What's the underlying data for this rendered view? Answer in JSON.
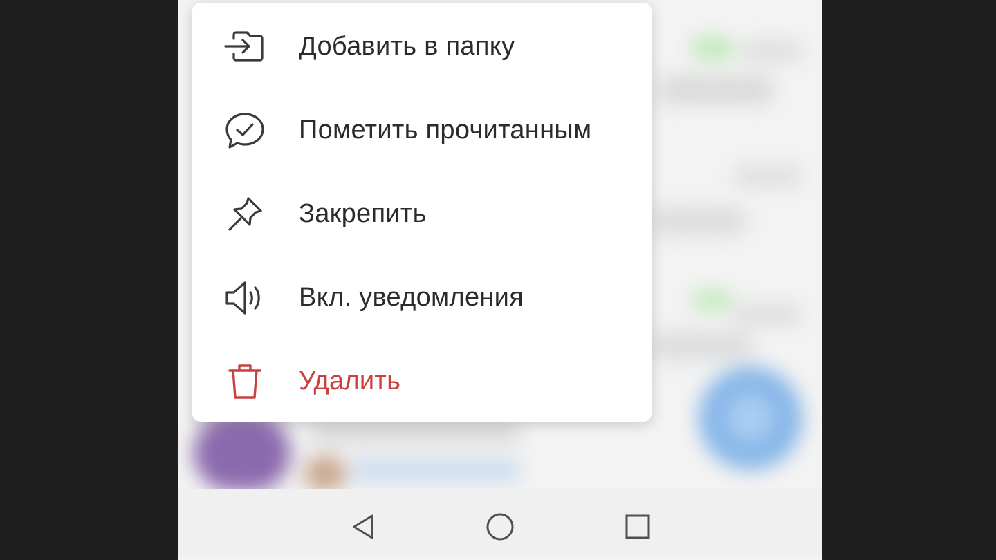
{
  "context_menu": {
    "items": [
      {
        "label": "Добавить в папку",
        "icon": "add-to-folder-icon"
      },
      {
        "label": "Пометить прочитанным",
        "icon": "mark-read-icon"
      },
      {
        "label": "Закрепить",
        "icon": "pin-icon"
      },
      {
        "label": "Вкл. уведомления",
        "icon": "speaker-icon"
      },
      {
        "label": "Удалить",
        "icon": "trash-icon"
      }
    ]
  },
  "navbar": {
    "buttons": [
      "back-icon",
      "home-icon",
      "recents-icon"
    ]
  },
  "colors": {
    "text": "#2b2b2b",
    "danger": "#c9403d",
    "icon": "#3a3a3a",
    "screen_bg": "#f3f3f3",
    "frame": "#1f1f1f"
  }
}
